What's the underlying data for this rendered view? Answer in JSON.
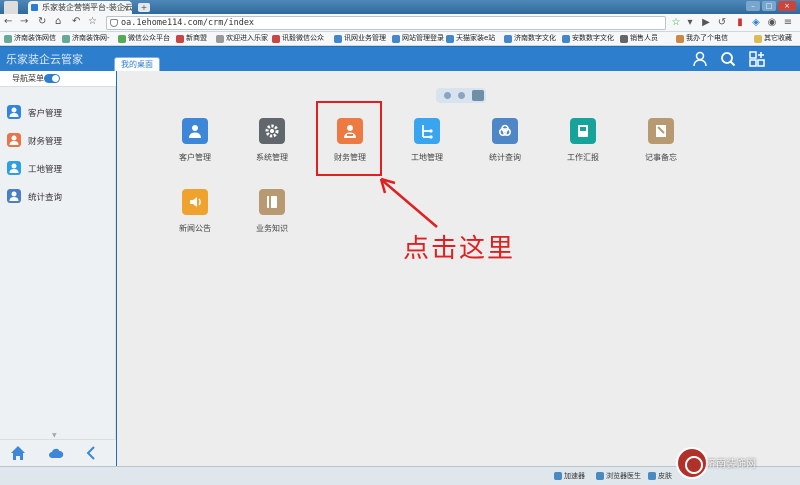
{
  "browser": {
    "tab_title": "乐家装企营销平台-装企云",
    "url": "oa.1ehome114.com/crm/index",
    "bookmarks": [
      "济南装饰网信",
      "济南装饰网-",
      "微信公众平台",
      "新商盟",
      "欢迎进入乐家",
      "讯毅微信公众",
      "讯网业务管理",
      "网站管理登录",
      "天猫家装e站",
      "济南数字文化",
      "安数数字文化",
      "销售人员",
      "我办了个电信",
      "其它收藏"
    ]
  },
  "app": {
    "brand": "乐家装企云管家",
    "active_tab": "我的桌面"
  },
  "sidebar": {
    "toggle_label": "导航菜单",
    "items": [
      {
        "label": "客户管理",
        "color": "#2e86de"
      },
      {
        "label": "财务管理",
        "color": "#e8744a"
      },
      {
        "label": "工地管理",
        "color": "#2e9ee6"
      },
      {
        "label": "统计查询",
        "color": "#4a7fc4"
      }
    ]
  },
  "desktop": {
    "apps": [
      {
        "label": "客户管理",
        "color": "#3d86d8",
        "icon": "user-icon"
      },
      {
        "label": "系统管理",
        "color": "#62676d",
        "icon": "gear-icon"
      },
      {
        "label": "财务管理",
        "color": "#ec7a42",
        "icon": "finance-user-icon"
      },
      {
        "label": "工地管理",
        "color": "#3aa5ef",
        "icon": "site-icon"
      },
      {
        "label": "统计查询",
        "color": "#4f86c6",
        "icon": "cloud-icon"
      },
      {
        "label": "工作汇报",
        "color": "#18a39a",
        "icon": "report-icon"
      },
      {
        "label": "记事备忘",
        "color": "#b79a72",
        "icon": "memo-icon"
      },
      {
        "label": "新闻公告",
        "color": "#f0a22e",
        "icon": "speaker-icon"
      },
      {
        "label": "业务知识",
        "color": "#b79a72",
        "icon": "book-icon"
      }
    ],
    "callout_text": "点击这里",
    "highlight_color": "#e02020"
  },
  "statusbar": {
    "items": [
      "加速器",
      "浏览器医生",
      "皮肤"
    ]
  },
  "watermark": {
    "text": "济南装饰网"
  }
}
